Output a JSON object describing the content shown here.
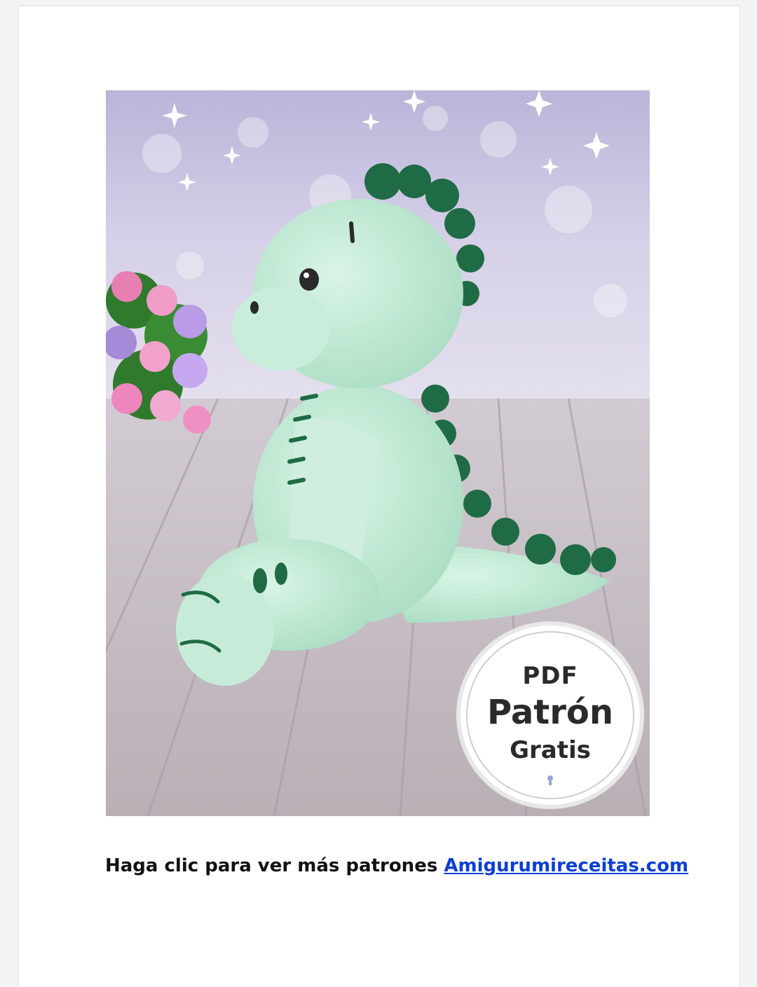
{
  "image": {
    "subject": "amigurumi-dinosaur-photo",
    "badge": {
      "line1": "PDF",
      "line2": "Patrón",
      "line3": "Gratis"
    }
  },
  "caption": {
    "text": "Haga clic para ver más patrones",
    "link_text": "Amigurumireceitas.com"
  },
  "colors": {
    "link": "#0b3fd6",
    "dino_body": "#bfe9d4",
    "dino_spikes": "#1f6b45",
    "wood_floor": "#c9c2c6",
    "background_bokeh": "#c7bfe0"
  }
}
